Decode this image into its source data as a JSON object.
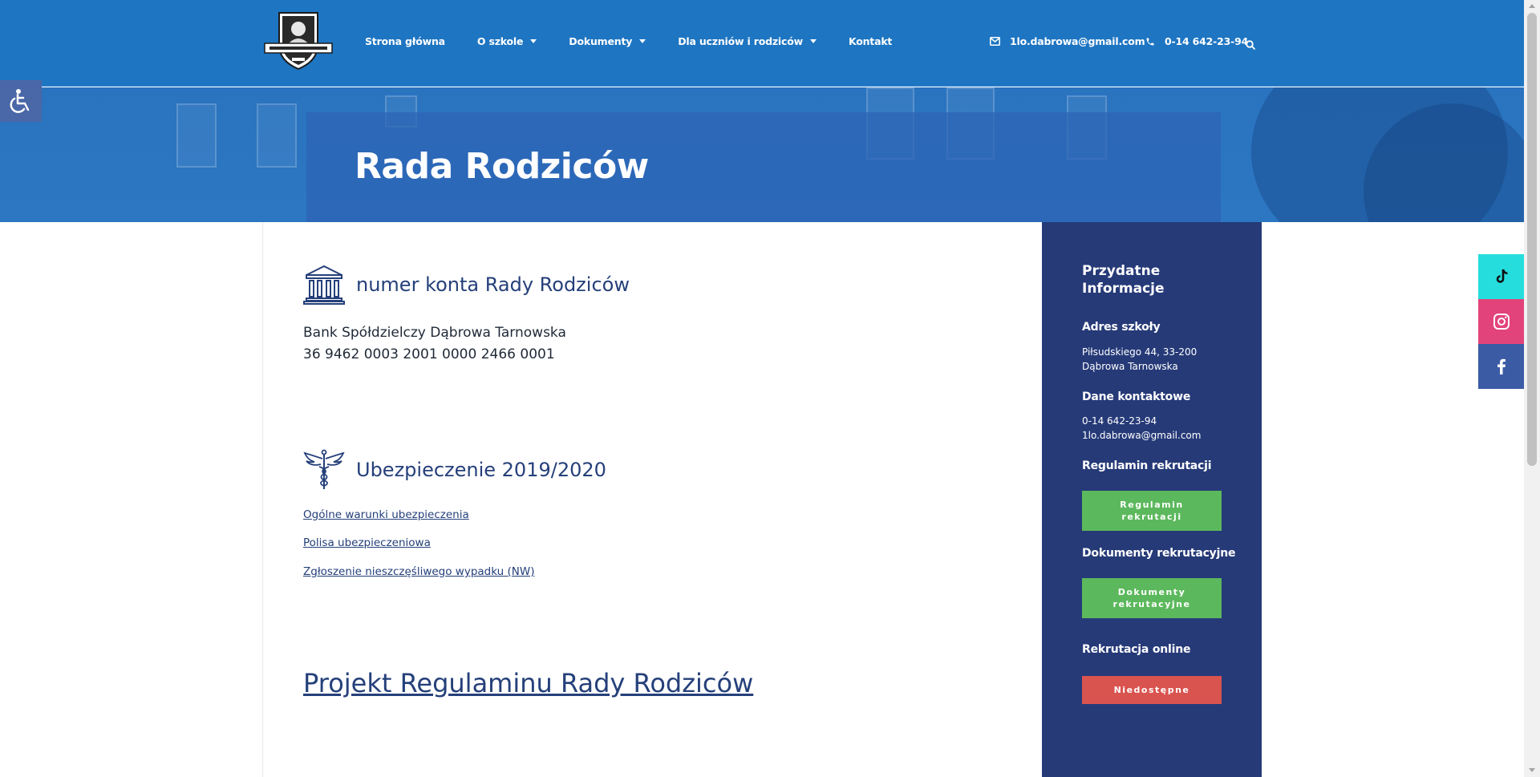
{
  "header": {
    "nav": [
      {
        "label": "Strona główna",
        "dropdown": false
      },
      {
        "label": "O szkole",
        "dropdown": true
      },
      {
        "label": "Dokumenty",
        "dropdown": true
      },
      {
        "label": "Dla uczniów i rodziców",
        "dropdown": true
      },
      {
        "label": "Kontakt",
        "dropdown": false
      }
    ],
    "email": "1lo.dabrowa@gmail.com",
    "phone": "0-14 642-23-94"
  },
  "page": {
    "title": "Rada Rodziców"
  },
  "content": {
    "account": {
      "heading": "numer konta Rady Rodziców",
      "bank": "Bank Spółdzielczy Dąbrowa Tarnowska",
      "number": "36 9462 0003 2001 0000 2466 0001"
    },
    "insurance": {
      "heading": "Ubezpieczenie 2019/2020",
      "links": [
        "Ogólne warunki ubezpieczenia",
        "Polisa ubezpieczeniowa",
        "Zgłoszenie nieszczęśliwego wypadku (NW)"
      ]
    },
    "regulation_link": "Projekt Regulaminu Rady Rodziców"
  },
  "sidebar": {
    "title": "Przydatne Informacje",
    "address_head": "Adres szkoły",
    "address_line1": "Piłsudskiego 44, 33-200",
    "address_line2": "Dąbrowa Tarnowska",
    "contact_head": "Dane kontaktowe",
    "contact_phone": "0-14 642-23-94",
    "contact_email": "1lo.dabrowa@gmail.com",
    "rules_head": "Regulamin rekrutacji",
    "rules_btn_1": "Regulamin",
    "rules_btn_2": "rekrutacji",
    "docs_head": "Dokumenty rekrutacyjne",
    "docs_btn_1": "Dokumenty",
    "docs_btn_2": "rekrutacyjne",
    "online_head": "Rekrutacja online",
    "online_btn": "Niedostępne"
  },
  "colors": {
    "header": "#1e75c2",
    "sidebar": "#263a78",
    "green_button": "#5cb85c",
    "red_button": "#d9534f",
    "tiktok": "#25dddd",
    "instagram": "#e2437a",
    "facebook": "#3b5ba5"
  }
}
